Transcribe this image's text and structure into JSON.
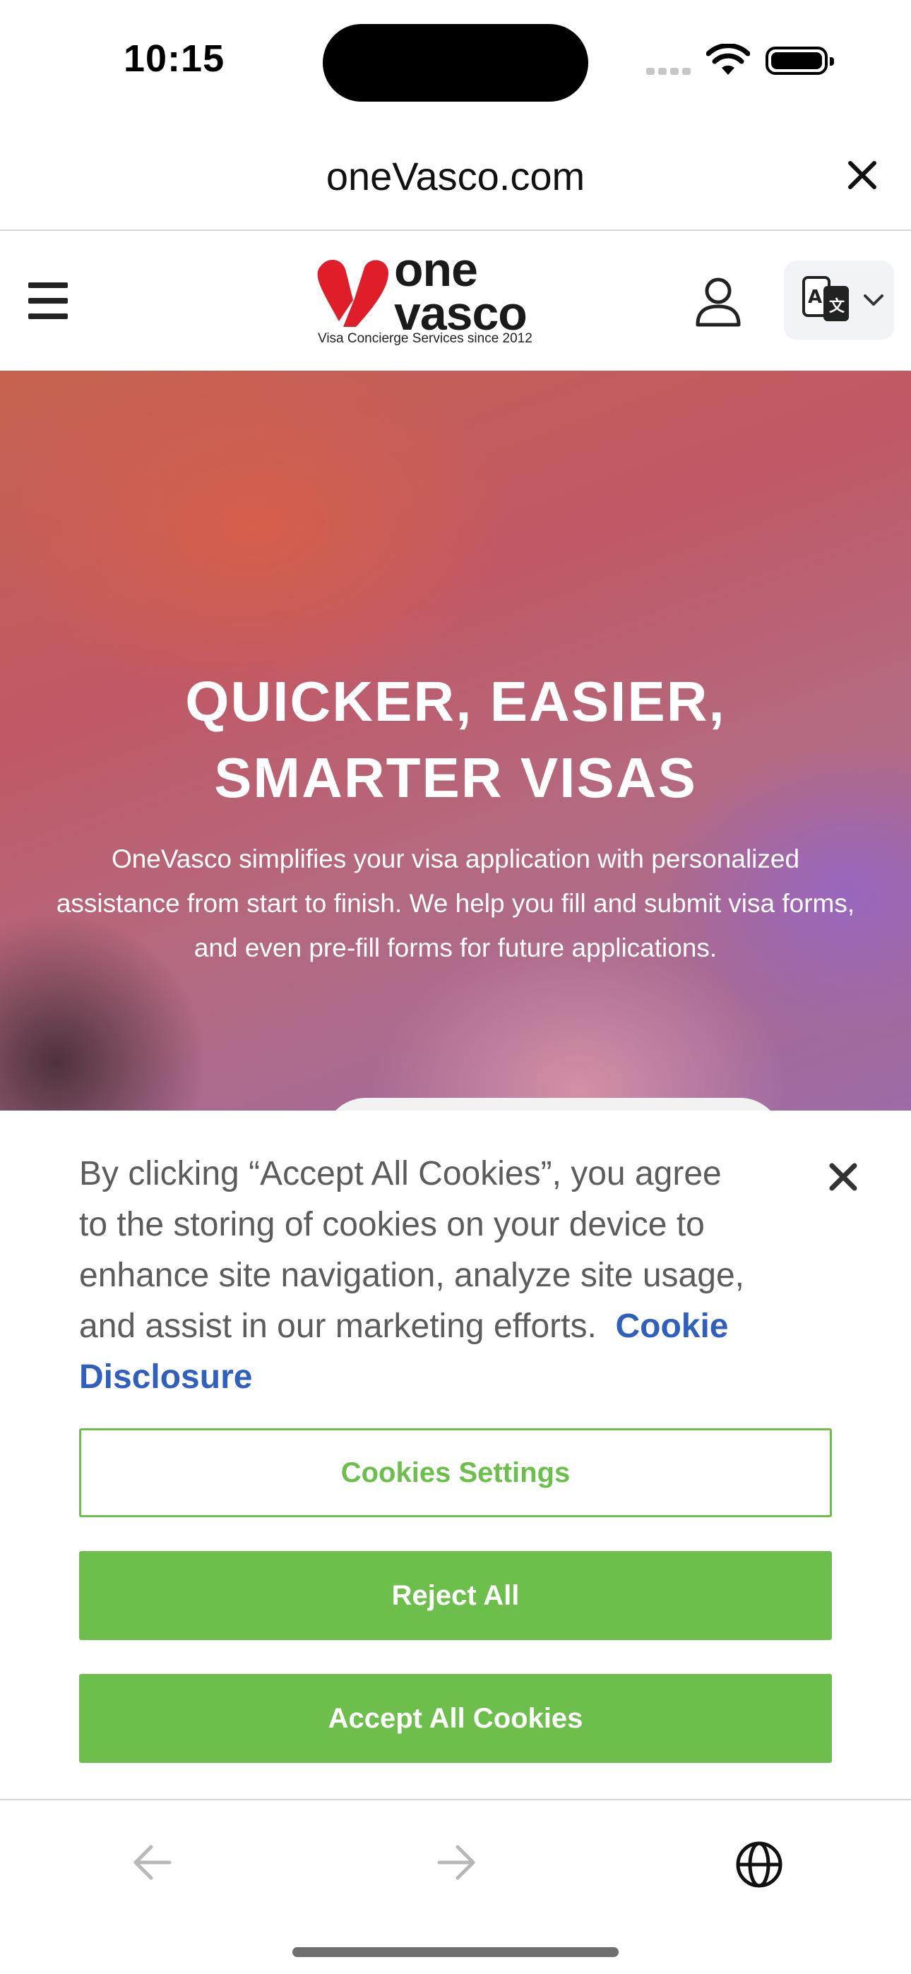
{
  "status_bar": {
    "time": "10:15"
  },
  "browser": {
    "url": "oneVasco.com"
  },
  "site_header": {
    "logo_line1": "one",
    "logo_line2": "vasco",
    "logo_tagline": "Visa Concierge Services since 2012",
    "brand_color": "#e01e2a"
  },
  "hero": {
    "title_line1": "QUICKER, EASIER,",
    "title_line2": "SMARTER VISAS",
    "body": "OneVasco simplifies your visa application with personalized assistance from start to finish. We help you fill and submit visa forms, and even pre-fill forms for future applications."
  },
  "cookie_banner": {
    "text": "By clicking “Accept All Cookies”, you agree to the storing of cookies on your device to enhance site navigation, analyze site usage, and assist in our marketing efforts.",
    "link": "Cookie Disclosure",
    "settings_label": "Cookies Settings",
    "reject_label": "Reject All",
    "accept_label": "Accept All Cookies",
    "accent_color": "#6cbf4a",
    "link_color": "#2f5fbf"
  },
  "icons": {
    "close": "close-icon",
    "menu": "hamburger-menu-icon",
    "account": "user-icon",
    "language": "translate-icon",
    "back": "arrow-left-icon",
    "forward": "arrow-right-icon",
    "web": "globe-icon"
  }
}
